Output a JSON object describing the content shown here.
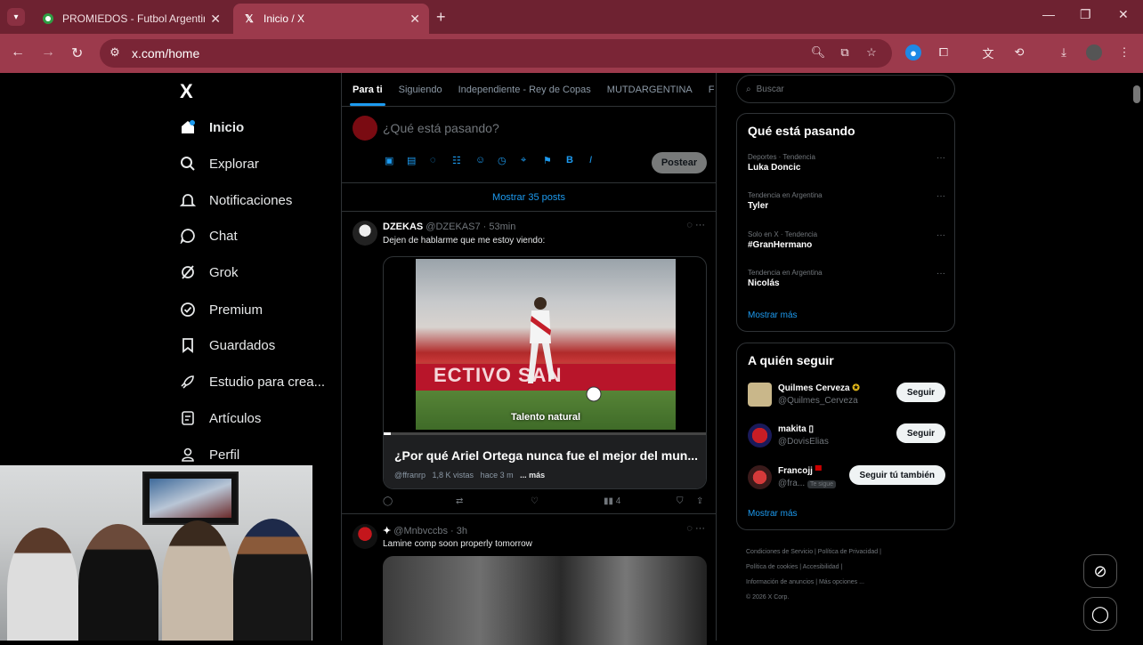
{
  "browser": {
    "tabs": [
      {
        "title": "PROMIEDOS - Futbol Argentino",
        "active": false
      },
      {
        "title": "Inicio / X",
        "active": true
      }
    ],
    "url": "x.com/home",
    "theme_color": "#9c3a4c"
  },
  "nav": {
    "logo": "X",
    "items": [
      {
        "label": "Inicio",
        "icon": "home-icon"
      },
      {
        "label": "Explorar",
        "icon": "search-icon"
      },
      {
        "label": "Notificaciones",
        "icon": "bell-icon"
      },
      {
        "label": "Chat",
        "icon": "chat-icon"
      },
      {
        "label": "Grok",
        "icon": "grok-icon"
      },
      {
        "label": "Premium",
        "icon": "premium-icon"
      },
      {
        "label": "Guardados",
        "icon": "bookmark-icon"
      },
      {
        "label": "Estudio para crea...",
        "icon": "rocket-icon"
      },
      {
        "label": "Artículos",
        "icon": "article-icon"
      },
      {
        "label": "Perfil",
        "icon": "profile-icon"
      }
    ]
  },
  "feed": {
    "tabs": [
      "Para ti",
      "Siguiendo",
      "Independiente - Rey de Copas",
      "MUTDARGENTINA",
      "F"
    ],
    "composer": {
      "placeholder": "¿Qué está pasando?",
      "post_label": "Postear"
    },
    "show_posts": "Mostrar 35 posts",
    "posts": [
      {
        "name": "DZEKAS",
        "meta": "@DZEKAS7 · 53min",
        "text": "Dejen de hablarme que me estoy viendo:",
        "video_caption": "Talento natural",
        "video_banner": "ECTIVO SAN",
        "card_title": "¿Por qué Ariel Ortega nunca fue el mejor del mun...",
        "card_meta_handle": "@ffranrp",
        "card_meta_views": "1,8 K vistas",
        "card_meta_time": "hace 3 m",
        "card_meta_more": "... más",
        "views": "4"
      },
      {
        "name": "✦",
        "meta": "@Mnbvccbs · 3h",
        "text": "Lamine comp soon properly tomorrow"
      }
    ]
  },
  "sidebar": {
    "search_placeholder": "Buscar",
    "trending_title": "Qué está pasando",
    "trends": [
      {
        "meta": "Deportes · Tendencia",
        "name": "Luka Doncic"
      },
      {
        "meta": "Tendencia en Argentina",
        "name": "Tyler"
      },
      {
        "meta": "Solo en X · Tendencia",
        "name": "#GranHermano"
      },
      {
        "meta": "Tendencia en Argentina",
        "name": "Nicolás"
      }
    ],
    "show_more": "Mostrar más",
    "who_title": "A quién seguir",
    "who": [
      {
        "name": "Quilmes Cerveza",
        "handle": "@Quilmes_Cerveza",
        "button": "Seguir"
      },
      {
        "name": "makita ▯",
        "handle": "@DovisElias",
        "button": "Seguir"
      },
      {
        "name": "Francojj",
        "handle": "@fra...",
        "badge": "Te sigue",
        "button": "Seguir tú también"
      }
    ],
    "who_more": "Mostrar más",
    "footer": {
      "line1": "Condiciones de Servicio  |  Política de Privacidad  |",
      "line2": "Política de cookies  |  Accesibilidad  |",
      "line3": "Información de anuncios  |  Más opciones ...",
      "line4": "© 2026 X Corp."
    }
  }
}
